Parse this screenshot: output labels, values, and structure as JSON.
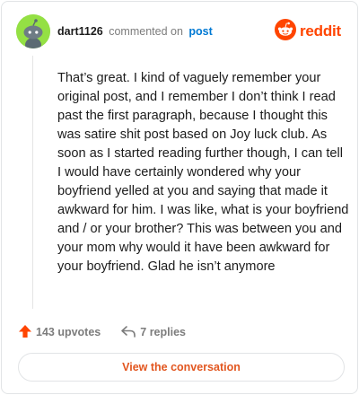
{
  "header": {
    "username": "dart1126",
    "action_text": "commented on",
    "target_text": "post",
    "brand": "reddit",
    "avatar_icon": "snoo-avatar-icon",
    "brand_icon": "reddit-logo-icon"
  },
  "comment": {
    "body": "That’s great. I kind of vaguely remember your original post, and I remember I don’t think I read past the first paragraph, because I thought this was satire shit post based on Joy luck club. As soon as I started reading further though, I can tell I would have certainly wondered why your boyfriend yelled at you and saying that made it awkward for him. I was like, what is your boyfriend and / or your brother? This was between you and your mom why would it have been awkward for your boyfriend. Glad he isn’t anymore"
  },
  "actions": {
    "upvotes": "143 upvotes",
    "replies": "7 replies",
    "upvote_icon": "upvote-arrow-icon",
    "reply_icon": "reply-arrow-icon"
  },
  "footer": {
    "view_button": "View the conversation"
  },
  "colors": {
    "brand": "#ff4500",
    "link": "#0079d3",
    "avatar_bg": "#94e044",
    "button_text": "#e2561f"
  }
}
